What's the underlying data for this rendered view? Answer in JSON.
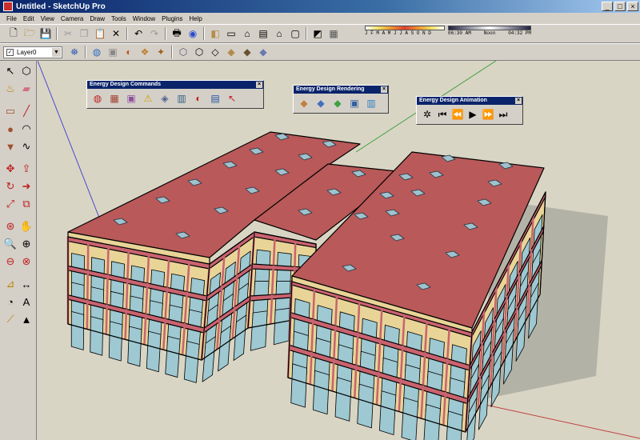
{
  "window": {
    "title": "Untitled - SketchUp Pro"
  },
  "menu": [
    "File",
    "Edit",
    "View",
    "Camera",
    "Draw",
    "Tools",
    "Window",
    "Plugins",
    "Help"
  ],
  "layer": {
    "current": "Layer0"
  },
  "shadow": {
    "months": "J F M A M J J A S O N D",
    "time_start": "06:30 AM",
    "time_noon": "Noon",
    "time_end": "04:32 PM"
  },
  "palettes": {
    "commands": {
      "title": "Energy Design Commands"
    },
    "rendering": {
      "title": "Energy Design Rendering"
    },
    "animation": {
      "title": "Energy Design Animation"
    }
  },
  "colors": {
    "roof": "#b95959",
    "wall": "#e8d497",
    "mullion": "#c9636f",
    "glass": "#9ec8d2",
    "skylight": "#9fc2cd",
    "ground": "#d9d5c4",
    "shadow": "#b3b2a6"
  }
}
